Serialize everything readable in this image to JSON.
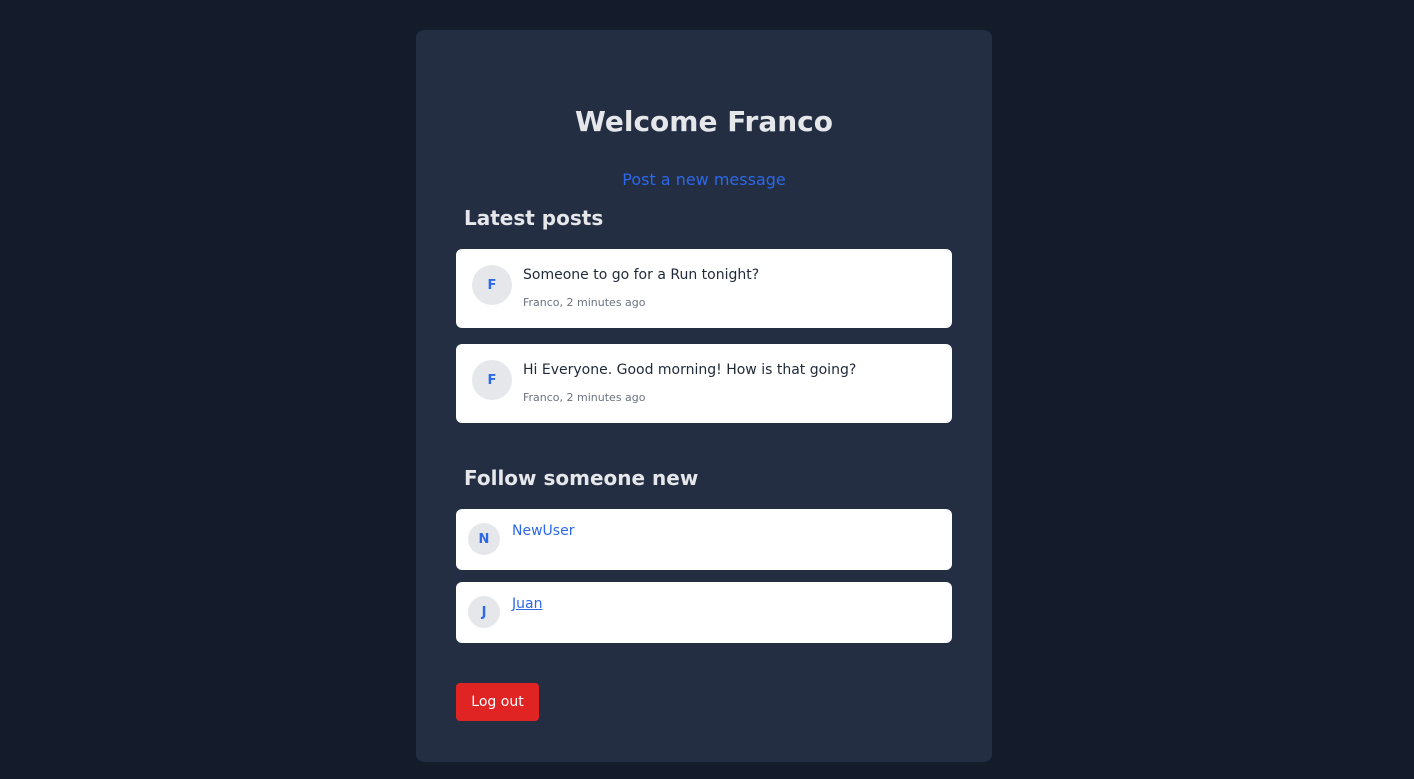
{
  "header": {
    "title": "Welcome Franco",
    "post_link": "Post a new message"
  },
  "posts": {
    "title": "Latest posts",
    "items": [
      {
        "avatar": "F",
        "text": "Someone to go for a Run tonight?",
        "meta": "Franco, 2 minutes ago"
      },
      {
        "avatar": "F",
        "text": "Hi Everyone. Good morning! How is that going?",
        "meta": "Franco, 2 minutes ago"
      }
    ]
  },
  "follow": {
    "title": "Follow someone new",
    "users": [
      {
        "avatar": "N",
        "name": "NewUser"
      },
      {
        "avatar": "J",
        "name": "Juan"
      }
    ]
  },
  "logout_label": "Log out",
  "colors": {
    "page_background": "#141b2b",
    "panel_background": "#232e42",
    "accent": "#2c68e8",
    "danger": "#e02424"
  }
}
